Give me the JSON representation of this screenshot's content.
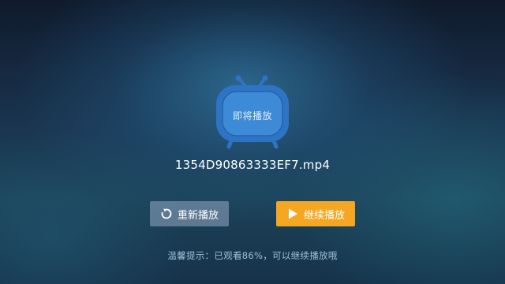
{
  "player": {
    "status_label": "即将播放",
    "filename": "1354D90863333EF7.mp4"
  },
  "actions": {
    "restart_label": "重新播放",
    "continue_label": "继续播放"
  },
  "tip": {
    "text": "温馨提示：已观看86%，可以继续播放哦",
    "watched_percent": 86
  },
  "colors": {
    "tv_blue": "#2e74c4",
    "continue_button": "#f5a623",
    "restart_button": "#7d93ab"
  },
  "icons": {
    "tv": "tv-icon",
    "restart": "replay-icon",
    "continue": "play-icon"
  }
}
